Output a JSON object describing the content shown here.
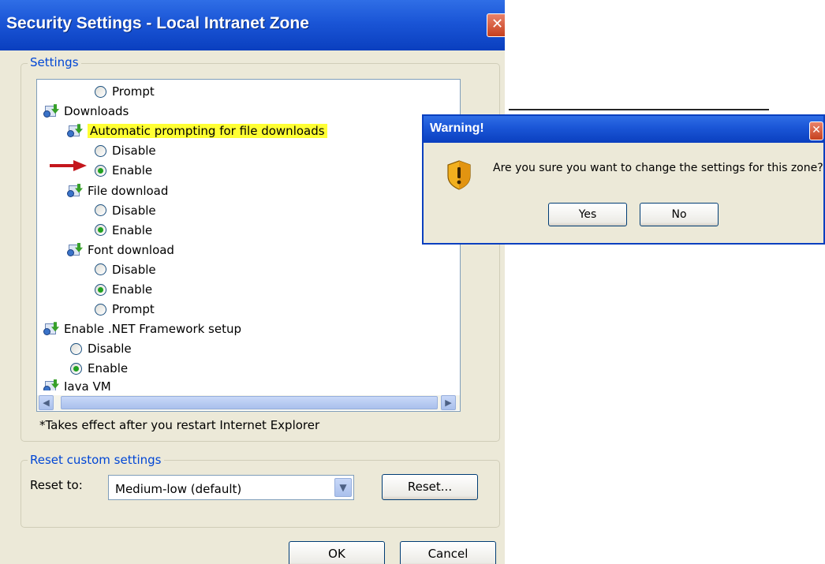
{
  "main_dialog": {
    "title": "Security Settings - Local Intranet Zone",
    "close_glyph": "✕",
    "settings_group_label": "Settings",
    "settings_tree": [
      {
        "type": "radio",
        "label": "Prompt",
        "checked": false,
        "indent": 1
      },
      {
        "type": "category",
        "label": "Downloads",
        "indent": 0
      },
      {
        "type": "category",
        "label": "Automatic prompting for file downloads",
        "indent": 1,
        "highlighted": true
      },
      {
        "type": "radio",
        "label": "Disable",
        "checked": false,
        "indent": 1
      },
      {
        "type": "radio",
        "label": "Enable",
        "checked": true,
        "indent": 1,
        "marked_with_arrow": true
      },
      {
        "type": "category",
        "label": "File download",
        "indent": 1
      },
      {
        "type": "radio",
        "label": "Disable",
        "checked": false,
        "indent": 1
      },
      {
        "type": "radio",
        "label": "Enable",
        "checked": true,
        "indent": 1
      },
      {
        "type": "category",
        "label": "Font download",
        "indent": 1
      },
      {
        "type": "radio",
        "label": "Disable",
        "checked": false,
        "indent": 1
      },
      {
        "type": "radio",
        "label": "Enable",
        "checked": true,
        "indent": 1
      },
      {
        "type": "radio",
        "label": "Prompt",
        "checked": false,
        "indent": 1
      },
      {
        "type": "category",
        "label": "Enable .NET Framework setup",
        "indent": 0
      },
      {
        "type": "radio",
        "label": "Disable",
        "checked": false,
        "indent": 0
      },
      {
        "type": "radio",
        "label": "Enable",
        "checked": true,
        "indent": 0
      },
      {
        "type": "category",
        "label": "Java VM",
        "indent": 0,
        "partially_visible": true
      }
    ],
    "restart_note": "*Takes effect after you restart Internet Explorer",
    "reset_group_label": "Reset custom settings",
    "reset_to_label": "Reset to:",
    "reset_select_value": "Medium-low (default)",
    "reset_button": "Reset...",
    "ok_button": "OK",
    "cancel_button": "Cancel"
  },
  "warning_dialog": {
    "title": "Warning!",
    "close_glyph": "✕",
    "message": "Are you sure you want to change the settings for this zone?",
    "yes_button": "Yes",
    "no_button": "No",
    "icon": "shield-warning-icon"
  },
  "colors": {
    "title_bar": "#0a3fbf",
    "group_label": "#0046d5",
    "highlight": "#ffff33",
    "arrow_marker": "#c4161c",
    "dialog_face": "#ece9d8"
  }
}
